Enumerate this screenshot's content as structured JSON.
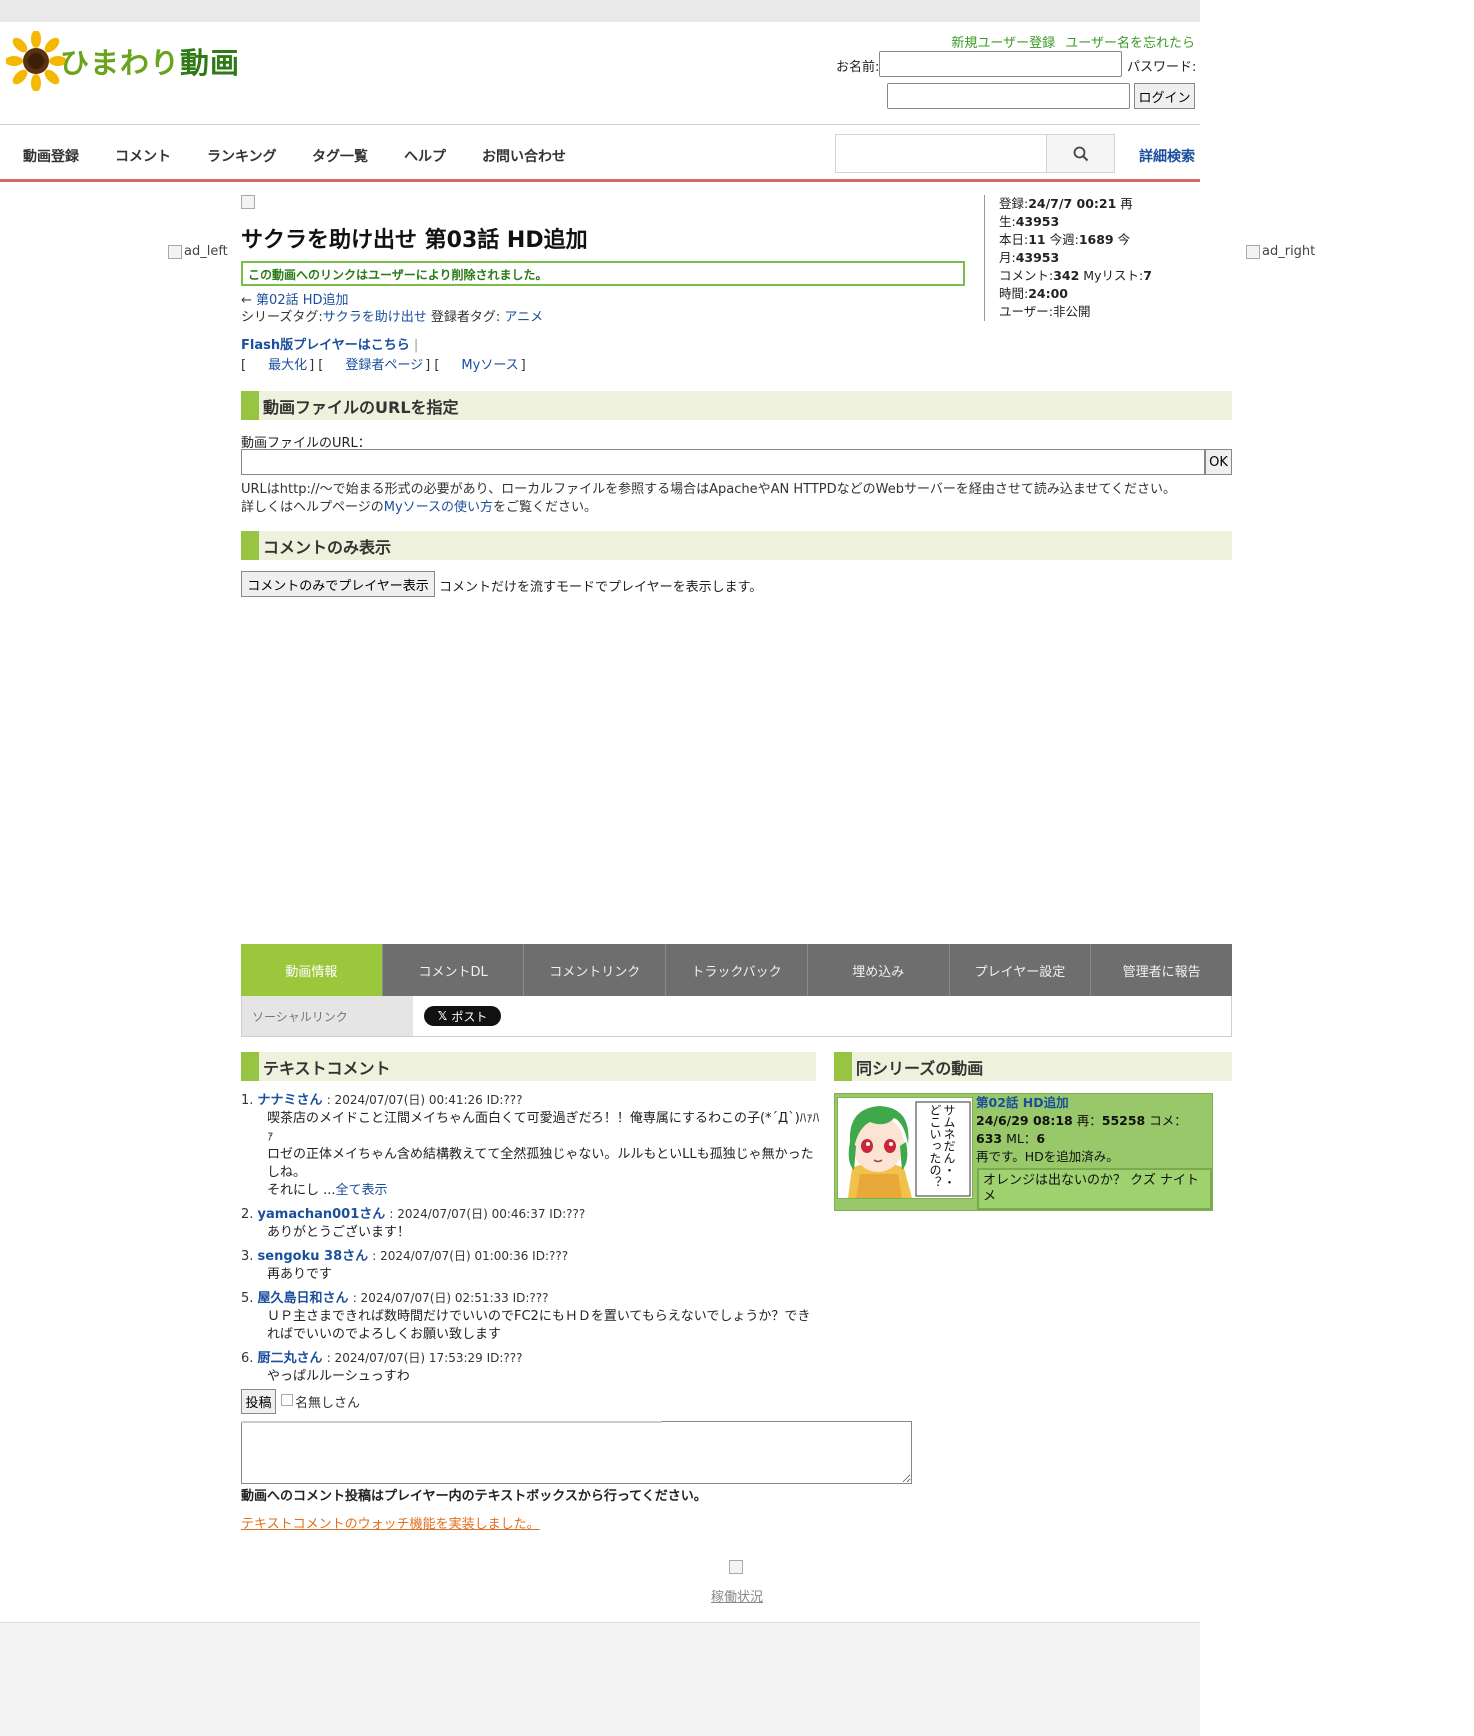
{
  "header": {
    "logo_text": "ひまわり",
    "logo_text_kanji": "動画",
    "register_link": "新規ユーザー登録",
    "forgot_link": "ユーザー名を忘れたら",
    "name_label": "お名前:",
    "password_label": "パスワード:",
    "login_button": "ログイン"
  },
  "nav": {
    "items": [
      "動画登録",
      "コメント",
      "ランキング",
      "タグ一覧",
      "ヘルプ",
      "お問い合わせ"
    ],
    "advanced_search": "詳細検索"
  },
  "ads": {
    "left": "ad_left",
    "right": "ad_right"
  },
  "video": {
    "title": "サクラを助け出せ 第03話 HD追加",
    "deleted_notice": "この動画へのリンクはユーザーにより削除されました。",
    "prev_arrow": "←",
    "prev_link": "第02話 HD追加",
    "series_tag_label": "シリーズタグ:",
    "series_tag": "サクラを助け出せ",
    "owner_tag_label": "登録者タグ:",
    "owner_tag": "アニメ",
    "flash_player_link": "Flash版プレイヤーはこちら",
    "flash_sep": "|",
    "maximize": "最大化",
    "uploader_page": "登録者ページ",
    "my_source": "Myソース"
  },
  "stats": {
    "registered_label": "登録:",
    "registered": "24/7/7 00:21",
    "plays_label": "再生:",
    "plays": "43953",
    "today_label": "本日:",
    "today": "11",
    "week_label": "今週:",
    "week": "1689",
    "month_label": "今月:",
    "month": "43953",
    "comments_label": "コメント:",
    "comments": "342",
    "mylist_label": "Myリスト:",
    "mylist": "7",
    "duration_label": "時間:",
    "duration": "24:00",
    "user_label": "ユーザー:",
    "user": "非公開"
  },
  "url_section": {
    "header": "動画ファイルのURLを指定",
    "label": "動画ファイルのURL：",
    "ok_button": "OK",
    "note_line1": "URLはhttp://〜で始まる形式の必要があり、ローカルファイルを参照する場合はApacheやAN HTTPDなどのWebサーバーを経由させて読み込ませてください。",
    "note_prefix": "詳しくはヘルプページの",
    "note_link": "Myソースの使い方",
    "note_suffix": "をご覧ください。"
  },
  "comment_only": {
    "header": "コメントのみ表示",
    "button": "コメントのみでプレイヤー表示",
    "description": "コメントだけを流すモードでプレイヤーを表示します。"
  },
  "tabs": [
    "動画情報",
    "コメントDL",
    "コメントリンク",
    "トラックバック",
    "埋め込み",
    "プレイヤー設定",
    "管理者に報告"
  ],
  "social": {
    "label": "ソーシャルリンク",
    "post": "ポスト"
  },
  "text_comments": {
    "header": "テキストコメント",
    "items": [
      {
        "num": "1.",
        "user": "ナナミさん",
        "meta": ": 2024/07/07(日) 00:41:26 ID:???",
        "lines": [
          "喫茶店のメイドこと江間メイちゃん面白くて可愛過ぎだろ！！俺専属にするわこの子(*´Д`)ﾊｧﾊｧ",
          "ロゼの正体メイちゃん含め結構教えてて全然孤独じゃない。ルルもといLLも孤独じゃ無かったしね。"
        ],
        "truncated": "それにし ...",
        "more": "全て表示"
      },
      {
        "num": "2.",
        "user": "yamachan001さん",
        "meta": ": 2024/07/07(日) 00:46:37 ID:???",
        "lines": [
          "ありがとうございます！"
        ]
      },
      {
        "num": "3.",
        "user": "sengoku 38さん",
        "meta": ": 2024/07/07(日) 01:00:36 ID:???",
        "lines": [
          "再ありです"
        ]
      },
      {
        "num": "5.",
        "user": "屋久島日和さん",
        "meta": ": 2024/07/07(日) 02:51:33 ID:???",
        "lines": [
          "ＵＰ主さまできれば数時間だけでいいのでFC2にもＨＤを置いてもらえないでしょうか？できればでいいのでよろしくお願い致します"
        ]
      },
      {
        "num": "6.",
        "user": "厨二丸さん",
        "meta": ": 2024/07/07(日) 17:53:29 ID:???",
        "lines": [
          "やっぱルルーシュっすわ"
        ]
      }
    ],
    "post_button": "投稿",
    "anon_label": "名無しさん",
    "post_note": "動画へのコメント投稿はプレイヤー内のテキストボックスから行ってください。",
    "watch_link": "テキストコメントのウォッチ機能を実装しました。"
  },
  "same_series": {
    "header": "同シリーズの動画",
    "thumb_caption": "サムネだん・・どこいったの？",
    "title": "第02話 HD追加",
    "date": "24/6/29 08:18",
    "plays_label": "再：",
    "plays": "55258",
    "comments_label": "コメ：",
    "comments": "633",
    "mylist_label": "ML：",
    "mylist": "6",
    "description": "再です。HDを追加済み。",
    "latest_comment": "オレンジは出ないのか？ クズ ナイトメ"
  },
  "footer": {
    "status_link": "稼働状況"
  }
}
